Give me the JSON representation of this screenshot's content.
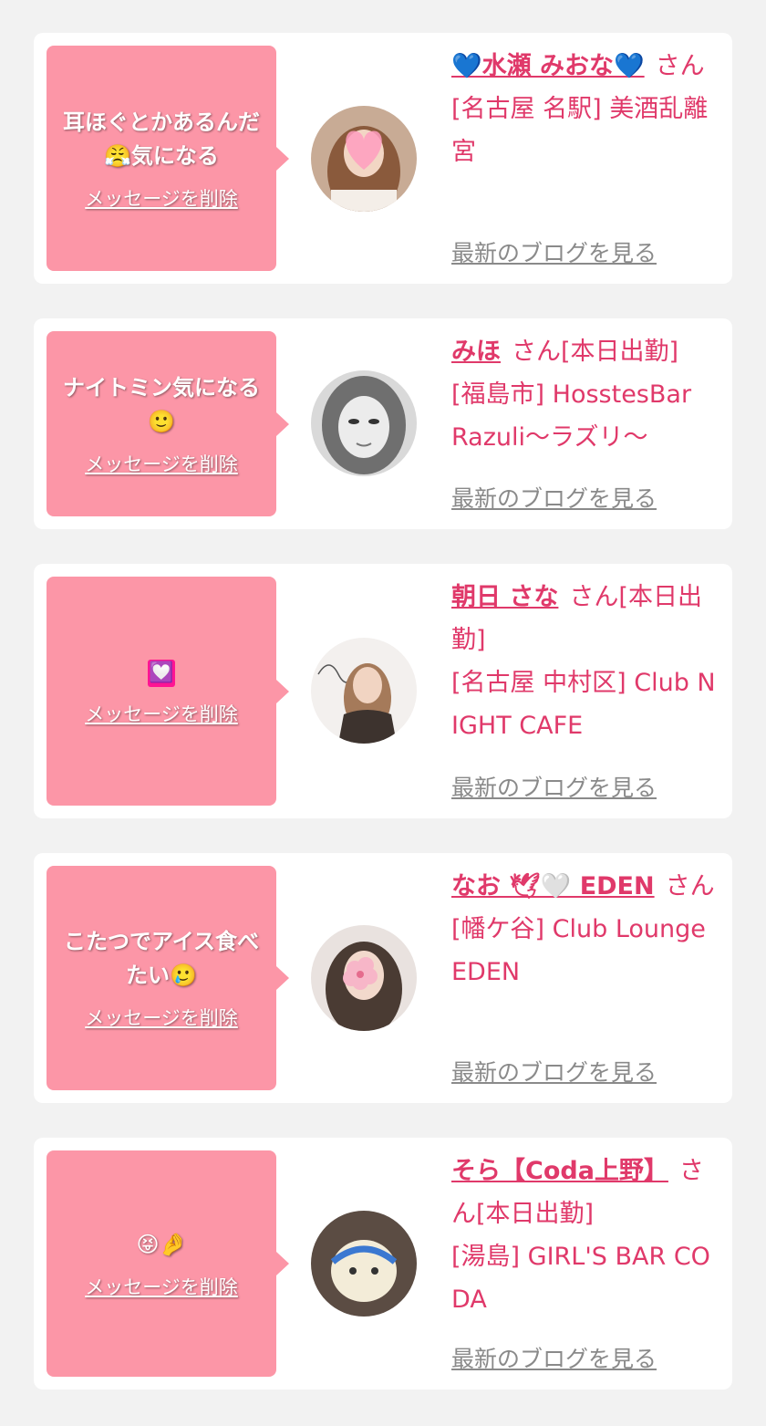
{
  "cards": [
    {
      "message": "耳ほぐとかあるんだ😤気になる",
      "delete_label": "メッセージを削除",
      "name": "💙水瀬 みおな💙",
      "suffix": "さん",
      "location": "[名古屋 名駅] 美酒乱離宮",
      "blog_label": "最新のブログを見る"
    },
    {
      "message": "ナイトミン気になる🙂",
      "delete_label": "メッセージを削除",
      "name": "みほ",
      "suffix": "さん[本日出勤]",
      "location": "[福島市] HosstesBar Razuli〜ラズリ〜",
      "blog_label": "最新のブログを見る"
    },
    {
      "message": "💟",
      "delete_label": "メッセージを削除",
      "name": "朝日 さな",
      "suffix": "さん[本日出勤]",
      "location": "[名古屋 中村区] Club NIGHT CAFE",
      "blog_label": "最新のブログを見る"
    },
    {
      "message": "こたつでアイス食べたい🥲",
      "delete_label": "メッセージを削除",
      "name": "なお 🕊🤍 EDEN",
      "suffix": "さん",
      "location": "[幡ケ谷] Club Lounge EDEN",
      "blog_label": "最新のブログを見る"
    },
    {
      "message": "😝🤌",
      "delete_label": "メッセージを削除",
      "name": "そら【Coda上野】",
      "suffix": "さん[本日出勤]",
      "location": "[湯島] GIRL'S BAR CODA",
      "blog_label": "最新のブログを見る"
    }
  ],
  "colors": {
    "page_bg": "#f2f2f2",
    "card_bg": "#ffffff",
    "bubble_pink": "#fc96a7",
    "accent_text": "#e0396a",
    "link_gray": "#8a8a8a"
  }
}
